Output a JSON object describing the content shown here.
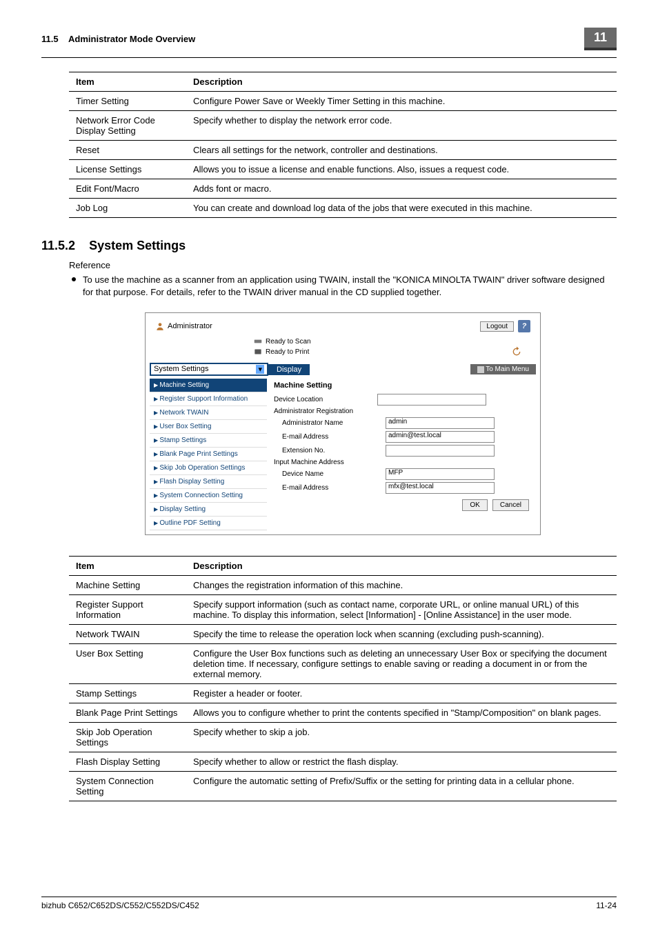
{
  "header": {
    "section": "11.5",
    "title": "Administrator Mode Overview",
    "chapter": "11"
  },
  "table1": {
    "headers": {
      "c1": "Item",
      "c2": "Description"
    },
    "rows": [
      {
        "c1": "Timer Setting",
        "c2": "Configure Power Save or Weekly Timer Setting in this machine."
      },
      {
        "c1": "Network Error Code Display Setting",
        "c2": "Specify whether to display the network error code."
      },
      {
        "c1": "Reset",
        "c2": "Clears all settings for the network, controller and destinations."
      },
      {
        "c1": "License Settings",
        "c2": "Allows you to issue a license and enable functions. Also, issues a request code."
      },
      {
        "c1": "Edit Font/Macro",
        "c2": "Adds font or macro."
      },
      {
        "c1": "Job Log",
        "c2": "You can create and download log data of the jobs that were executed in this machine."
      }
    ]
  },
  "sub": {
    "num": "11.5.2",
    "title": "System Settings",
    "ref": "Reference",
    "bullet": "To use the machine as a scanner from an application using TWAIN, install the \"KONICA MINOLTA TWAIN\" driver software designed for that purpose. For details, refer to the TWAIN driver manual in the CD supplied together."
  },
  "shot": {
    "admin": "Administrator",
    "logout": "Logout",
    "help": "?",
    "ready1": "Ready to Scan",
    "ready2": "Ready to Print",
    "select": "System Settings",
    "display": "Display",
    "tmm": "To Main Menu",
    "nav": [
      "Machine Setting",
      "Register Support Information",
      "Network TWAIN",
      "User Box Setting",
      "Stamp Settings",
      "Blank Page Print Settings",
      "Skip Job Operation Settings",
      "Flash Display Setting",
      "System Connection Setting",
      "Display Setting",
      "Outline PDF Setting"
    ],
    "main_title": "Machine Setting",
    "fields": [
      {
        "lbl": "Device Location",
        "val": ""
      },
      {
        "lbl": "Administrator Registration",
        "val": null
      },
      {
        "lbl": "Administrator Name",
        "val": "admin"
      },
      {
        "lbl": "E-mail Address",
        "val": "admin@test.local"
      },
      {
        "lbl": "Extension No.",
        "val": ""
      },
      {
        "lbl": "Input Machine Address",
        "val": null
      },
      {
        "lbl": "Device Name",
        "val": "MFP"
      },
      {
        "lbl": "E-mail Address",
        "val": "mfx@test.local"
      }
    ],
    "ok": "OK",
    "cancel": "Cancel"
  },
  "table2": {
    "headers": {
      "c1": "Item",
      "c2": "Description"
    },
    "rows": [
      {
        "c1": "Machine Setting",
        "c2": "Changes the registration information of this machine."
      },
      {
        "c1": "Register Support Information",
        "c2": "Specify support information (such as contact name, corporate URL, or online manual URL) of this machine. To display this information, select [Information] - [Online Assistance] in the user mode."
      },
      {
        "c1": "Network TWAIN",
        "c2": "Specify the time to release the operation lock when scanning (excluding push-scanning)."
      },
      {
        "c1": "User Box Setting",
        "c2": "Configure the User Box functions such as deleting an unnecessary User Box or specifying the document deletion time. If necessary, configure settings to enable saving or reading a document in or from the external memory."
      },
      {
        "c1": "Stamp Settings",
        "c2": "Register a header or footer."
      },
      {
        "c1": "Blank Page Print Settings",
        "c2": "Allows you to configure whether to print the contents specified in \"Stamp/Composition\" on blank pages."
      },
      {
        "c1": "Skip Job Operation Settings",
        "c2": "Specify whether to skip a job."
      },
      {
        "c1": "Flash Display Setting",
        "c2": "Specify whether to allow or restrict the flash display."
      },
      {
        "c1": "System Connection Setting",
        "c2": "Configure the automatic setting of Prefix/Suffix or the setting for printing data in a cellular phone."
      }
    ]
  },
  "footer": {
    "l": "bizhub C652/C652DS/C552/C552DS/C452",
    "r": "11-24"
  }
}
